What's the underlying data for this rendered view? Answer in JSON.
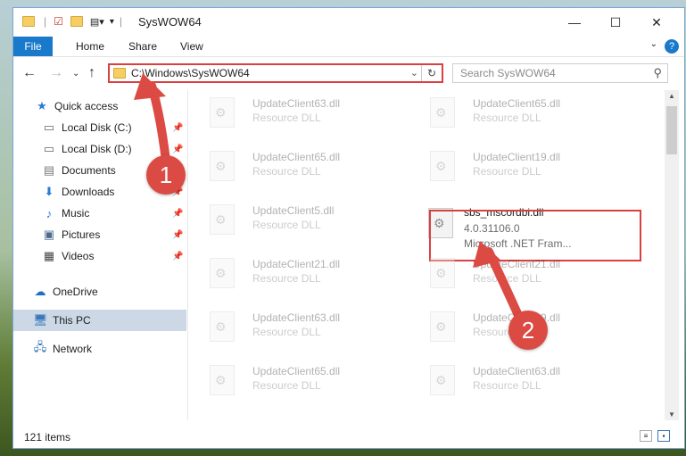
{
  "window": {
    "title": "SysWOW64",
    "controls": {
      "minimize": "—",
      "maximize": "☐",
      "close": "✕"
    }
  },
  "ribbon": {
    "tabs": [
      "File",
      "Home",
      "Share",
      "View"
    ],
    "help": "?"
  },
  "address_bar": {
    "path": "C:\\Windows\\SysWOW64",
    "search_placeholder": "Search SysWOW64"
  },
  "sidebar": {
    "items": [
      {
        "label": "Quick access",
        "icon": "star-icon"
      },
      {
        "label": "Local Disk (C:)",
        "icon": "drive-icon"
      },
      {
        "label": "Local Disk (D:)",
        "icon": "drive-icon"
      },
      {
        "label": "Documents",
        "icon": "documents-icon"
      },
      {
        "label": "Downloads",
        "icon": "downloads-icon"
      },
      {
        "label": "Music",
        "icon": "music-icon"
      },
      {
        "label": "Pictures",
        "icon": "pictures-icon"
      },
      {
        "label": "Videos",
        "icon": "videos-icon"
      },
      {
        "label": "OneDrive",
        "icon": "cloud-icon"
      },
      {
        "label": "This PC",
        "icon": "computer-icon"
      },
      {
        "label": "Network",
        "icon": "network-icon"
      }
    ],
    "selected": "This PC"
  },
  "files": {
    "left_column": [
      {
        "name": "UpdateClient63.dll",
        "type": "Resource DLL"
      },
      {
        "name": "UpdateClient65.dll",
        "type": "Resource DLL"
      },
      {
        "name": "UpdateClient5.dll",
        "type": "Resource DLL"
      },
      {
        "name": "UpdateClient21.dll",
        "type": "Resource DLL"
      },
      {
        "name": "UpdateClient63.dll",
        "type": "Resource DLL"
      },
      {
        "name": "UpdateClient65.dll",
        "type": "Resource DLL"
      }
    ],
    "right_column": [
      {
        "name": "UpdateClient65.dll",
        "type": "Resource DLL"
      },
      {
        "name": "UpdateClient19.dll",
        "type": "Resource DLL"
      },
      {
        "name": "sbs_mscordbi.dll",
        "version": "4.0.31106.0",
        "type": "Microsoft .NET Fram...",
        "highlighted": true
      },
      {
        "name": "UpdateClient21.dll",
        "type": "Resource DLL"
      },
      {
        "name": "UpdateClient19.dll",
        "type": "Resource DLL"
      },
      {
        "name": "UpdateClient63.dll",
        "type": "Resource DLL"
      }
    ]
  },
  "status_bar": {
    "item_count": "121 items"
  },
  "annotations": {
    "step1": "1",
    "step2": "2",
    "color": "#dc4a44"
  }
}
